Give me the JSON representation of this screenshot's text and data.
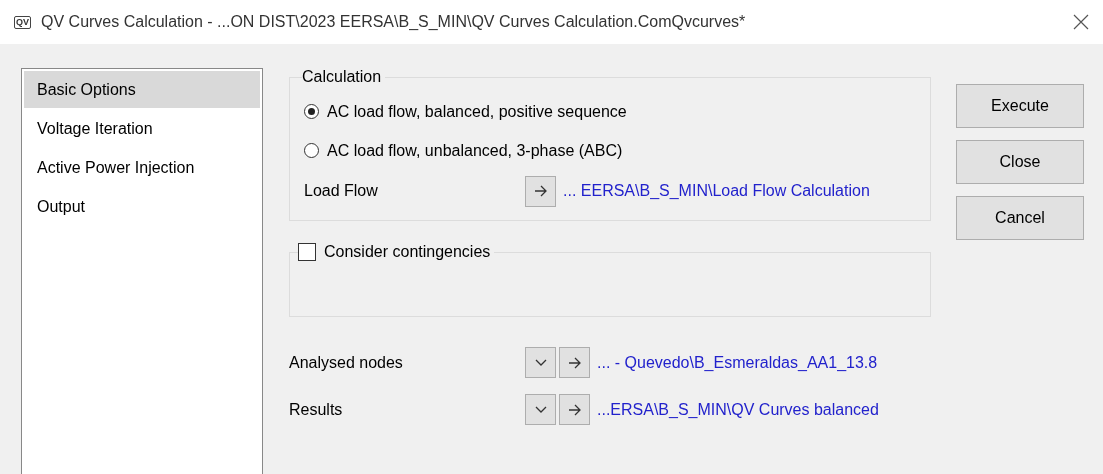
{
  "window": {
    "title": "QV Curves Calculation - ...ON DIST\\2023 EERSA\\B_S_MIN\\QV Curves Calculation.ComQvcurves*",
    "app_badge": "QV"
  },
  "sidebar": {
    "items": [
      {
        "label": "Basic Options",
        "selected": true
      },
      {
        "label": "Voltage Iteration",
        "selected": false
      },
      {
        "label": "Active Power Injection",
        "selected": false
      },
      {
        "label": "Output",
        "selected": false
      }
    ]
  },
  "calculation": {
    "title": "Calculation",
    "options": [
      {
        "label": "AC load flow, balanced, positive sequence",
        "selected": true
      },
      {
        "label": "AC load flow, unbalanced, 3-phase (ABC)",
        "selected": false
      }
    ],
    "load_flow": {
      "label": "Load Flow",
      "link": "... EERSA\\B_S_MIN\\Load Flow Calculation"
    }
  },
  "contingencies": {
    "label": "Consider contingencies",
    "checked": false
  },
  "references": [
    {
      "label": "Analysed nodes",
      "link": "... - Quevedo\\B_Esmeraldas_AA1_13.8"
    },
    {
      "label": "Results",
      "link": "...ERSA\\B_S_MIN\\QV Curves balanced"
    }
  ],
  "buttons": [
    "Execute",
    "Close",
    "Cancel"
  ]
}
